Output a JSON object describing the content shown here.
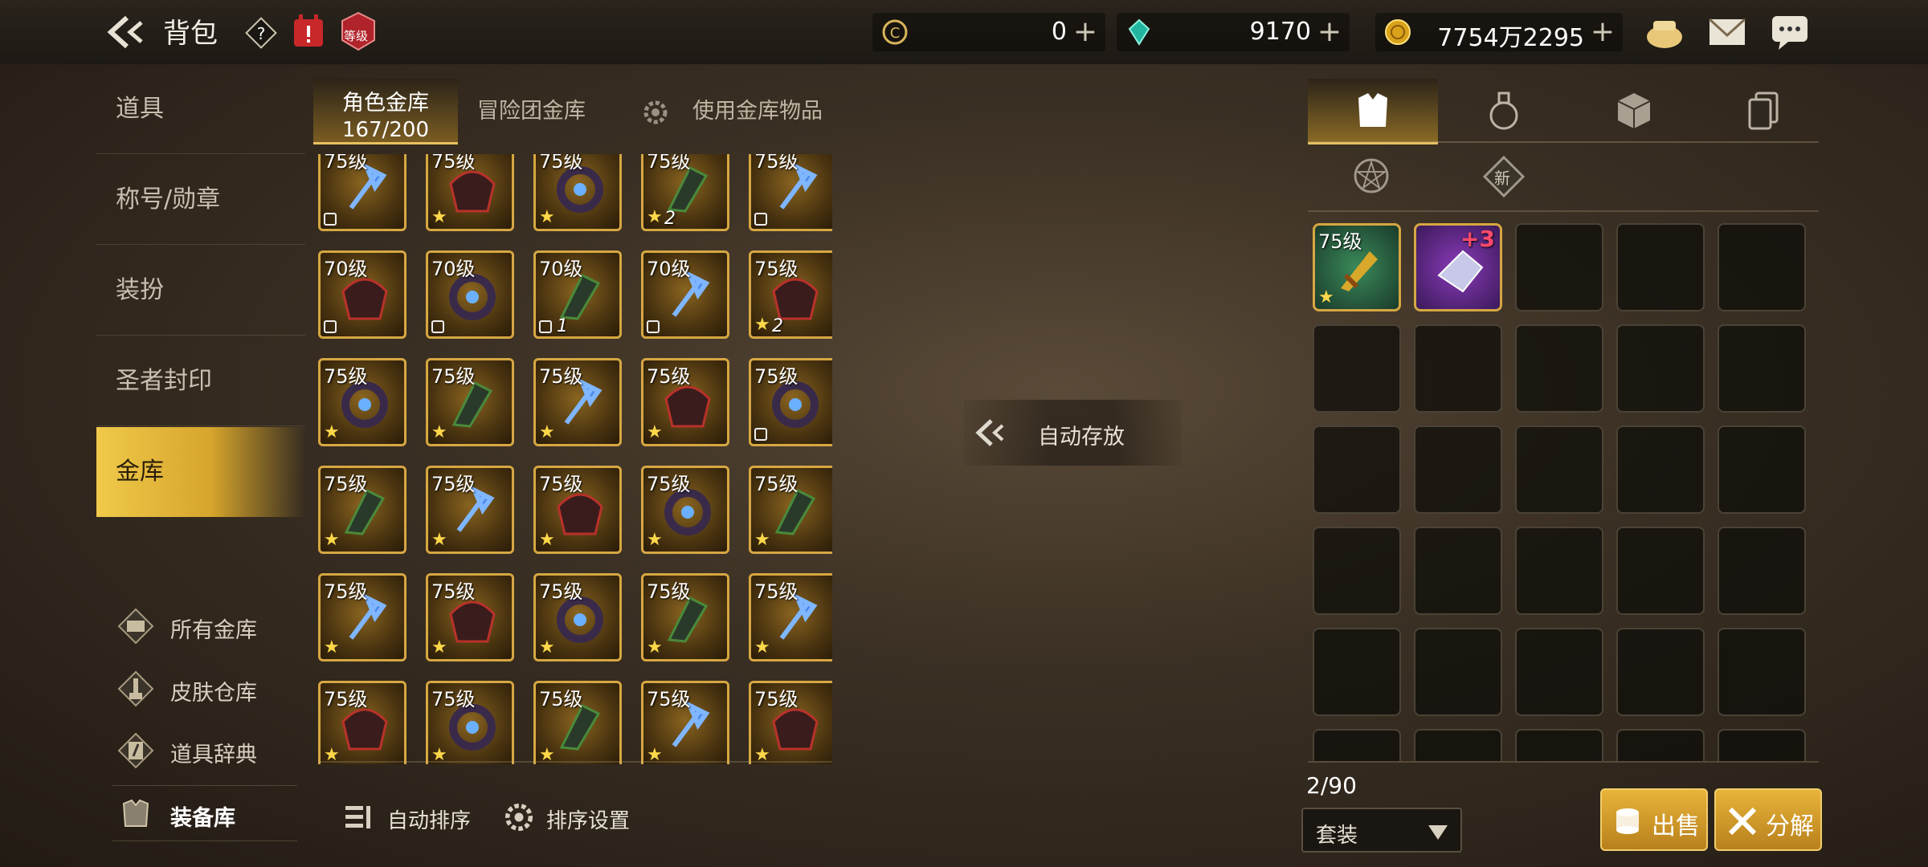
{
  "header": {
    "title": "背包",
    "level_badge": "等级"
  },
  "currencies": [
    {
      "icon": "c-coin-icon",
      "value": "0",
      "plus": "+"
    },
    {
      "icon": "green-gem-icon",
      "value": "9170",
      "plus": "+"
    },
    {
      "icon": "gold-coin-icon",
      "value": "7754万2295",
      "plus": "+"
    }
  ],
  "nav": {
    "items": [
      "道具",
      "称号/勋章",
      "装扮",
      "圣者封印",
      "金库"
    ],
    "active": "金库",
    "sub_items": [
      "所有金库",
      "皮肤仓库",
      "道具辞典",
      "装备库"
    ]
  },
  "tabs": {
    "character_vault": "角色金库",
    "character_count": "167/200",
    "adventure_vault": "冒险团金库",
    "use_items": "使用金库物品"
  },
  "grid": {
    "rows": [
      {
        "cells": [
          {
            "lv": "75级",
            "mark": "lock"
          },
          {
            "lv": "75级",
            "mark": "star"
          },
          {
            "lv": "75级",
            "mark": "star"
          },
          {
            "lv": "75级",
            "mark": "star",
            "count": "2"
          },
          {
            "lv": "75级",
            "mark": "lock"
          }
        ]
      },
      {
        "cells": [
          {
            "lv": "70级",
            "mark": "lock"
          },
          {
            "lv": "70级",
            "mark": "lock"
          },
          {
            "lv": "70级",
            "mark": "lock",
            "count": "1"
          },
          {
            "lv": "70级",
            "mark": "lock"
          },
          {
            "lv": "75级",
            "mark": "star",
            "count": "2"
          }
        ]
      },
      {
        "cells": [
          {
            "lv": "75级",
            "mark": "star"
          },
          {
            "lv": "75级",
            "mark": "star"
          },
          {
            "lv": "75级",
            "mark": "star"
          },
          {
            "lv": "75级",
            "mark": "star"
          },
          {
            "lv": "75级",
            "mark": "lock"
          }
        ]
      },
      {
        "cells": [
          {
            "lv": "75级",
            "mark": "star"
          },
          {
            "lv": "75级",
            "mark": "star"
          },
          {
            "lv": "75级",
            "mark": "star"
          },
          {
            "lv": "75级",
            "mark": "star"
          },
          {
            "lv": "75级",
            "mark": "star"
          }
        ]
      },
      {
        "cells": [
          {
            "lv": "75级",
            "mark": "star"
          },
          {
            "lv": "75级",
            "mark": "star"
          },
          {
            "lv": "75级",
            "mark": "star"
          },
          {
            "lv": "75级",
            "mark": "star"
          },
          {
            "lv": "75级",
            "mark": "star"
          }
        ]
      },
      {
        "cells": [
          {
            "lv": "75级",
            "mark": "star"
          },
          {
            "lv": "75级",
            "mark": "star"
          },
          {
            "lv": "75级",
            "mark": "star"
          },
          {
            "lv": "75级",
            "mark": "star"
          },
          {
            "lv": "75级",
            "mark": "star"
          }
        ]
      }
    ]
  },
  "bottom": {
    "auto_sort": "自动排序",
    "sort_settings": "排序设置"
  },
  "auto_store": "自动存放",
  "right": {
    "new_badge": "新",
    "first_item_level": "75级",
    "second_item_plus": "+3",
    "capacity": "2/90",
    "filter": "套装",
    "sell": "出售",
    "disassemble": "分解"
  },
  "colors": {
    "gold": "#d6a742",
    "accent": "#e8c060"
  }
}
